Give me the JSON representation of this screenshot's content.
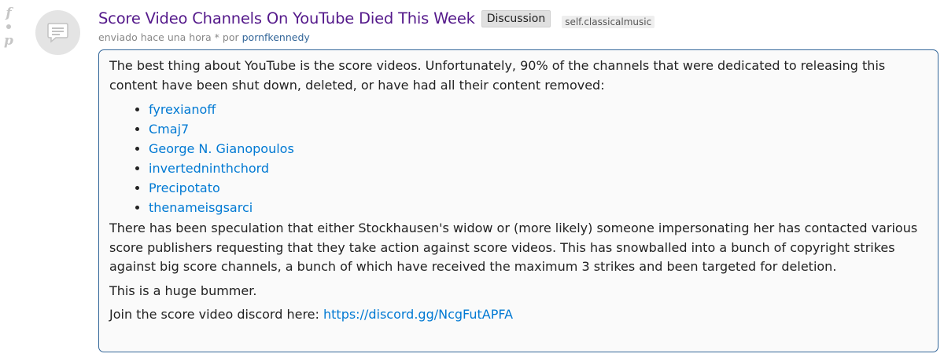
{
  "votes": {
    "up_glyph": "f",
    "down_glyph": "p"
  },
  "thumbnail": {
    "icon": "self-text-icon"
  },
  "post": {
    "title": "Score Video Channels On YouTube Died This Week",
    "flair": "Discussion",
    "domain": "self.classicalmusic",
    "tagline": {
      "submitted": "enviado hace una hora",
      "asterisk": "*",
      "by": "por",
      "author": "pornfkennedy"
    }
  },
  "body": {
    "intro": "The best thing about YouTube is the score videos. Unfortunately, 90% of the channels that were dedicated to releasing this content have been shut down, deleted, or have had all their content removed:",
    "channels": [
      "fyrexianoff",
      "Cmaj7",
      "George N. Gianopoulos",
      "invertedninthchord",
      "Precipotato",
      "thenameisgsarci"
    ],
    "speculation": "There has been speculation that either Stockhausen's widow or (more likely) someone impersonating her has contacted various score publishers requesting that they take action against score videos. This has snowballed into a bunch of copyright strikes against big score channels, a bunch of which have received the maximum 3 strikes and been targeted for deletion.",
    "bummer": "This is a huge bummer.",
    "discord_prefix": "Join the score video discord here:",
    "discord_link": "https://discord.gg/NcgFutAPFA"
  },
  "colors": {
    "title": "#551a8b",
    "link": "#0079d3",
    "border": "#336699"
  }
}
